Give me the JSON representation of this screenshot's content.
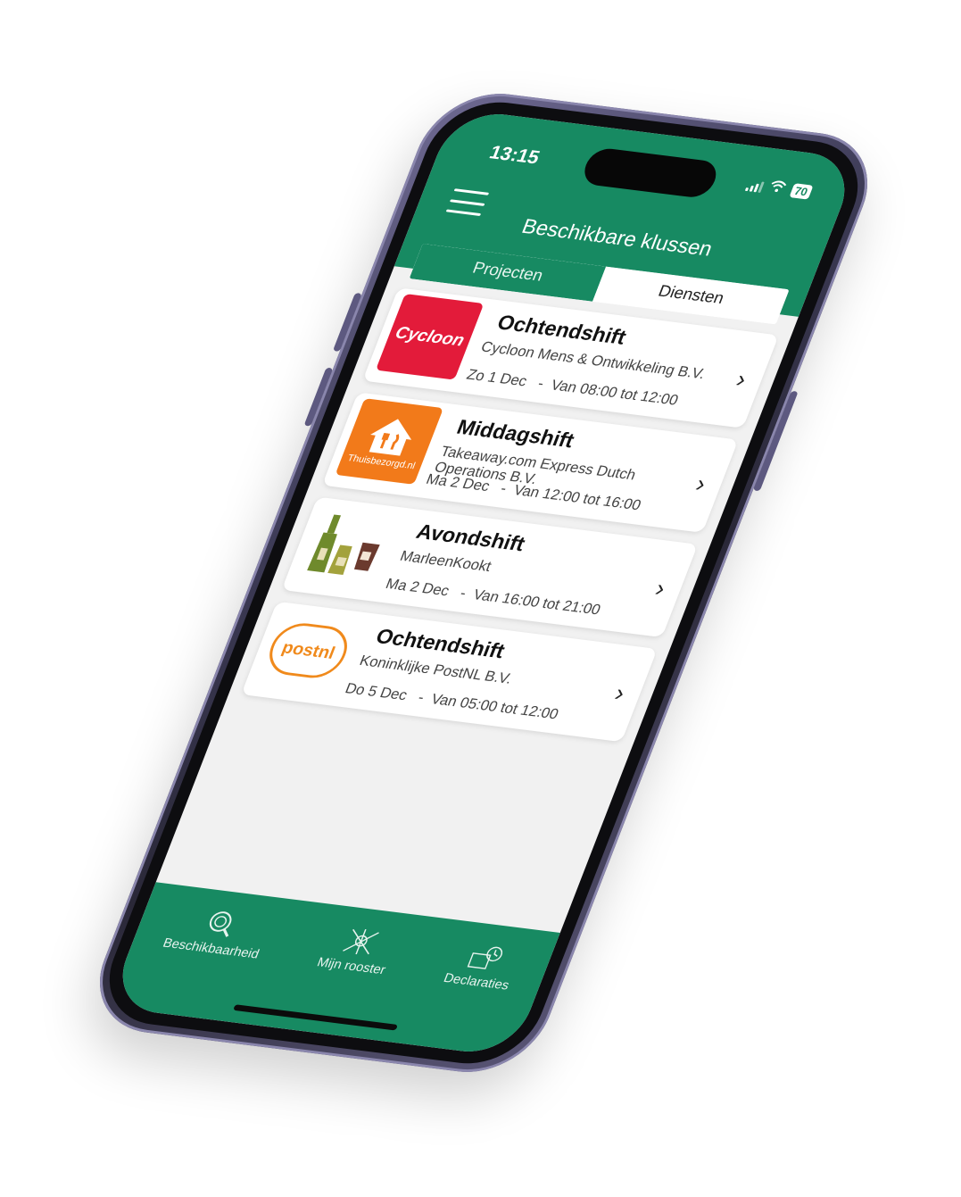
{
  "status_bar": {
    "time": "13:15",
    "battery": "70",
    "icons": [
      "signal-icon",
      "wifi-icon",
      "battery-icon"
    ]
  },
  "header": {
    "menu_icon": "hamburger-menu-icon",
    "title": "Beschikbare klussen"
  },
  "tabs": [
    {
      "label": "Projecten",
      "active": true
    },
    {
      "label": "Diensten",
      "active": false
    }
  ],
  "jobs": [
    {
      "title": "Ochtendshift",
      "company": "Cycloon Mens & Ontwikkeling B.V.",
      "when": "Zo 1 Dec   -  Van 08:00 tot 12:00",
      "logo_text": "Cycloon",
      "logo_color": "#e31b3a"
    },
    {
      "title": "Middagshift",
      "company": "Takeaway.com Express Dutch Operations B.V.",
      "when": "Ma 2 Dec   -  Van 12:00 tot 16:00",
      "logo_text": "Thuisbezorgd.nl",
      "logo_color": "#f27a1a"
    },
    {
      "title": "Avondshift",
      "company": "MarleenKookt",
      "when": "Ma 2 Dec   -  Van 16:00 tot 21:00",
      "logo_text": "",
      "logo_color": "#6f8a2c"
    },
    {
      "title": "Ochtendshift",
      "company": "Koninklijke PostNL B.V.",
      "when": "Do 5 Dec   -  Van 05:00 tot 12:00",
      "logo_text": "postnl",
      "logo_color": "#f08a1c"
    }
  ],
  "bottom_nav": [
    {
      "label": "Beschikbaarheid",
      "icon": "availability-icon"
    },
    {
      "label": "Mijn rooster",
      "icon": "schedule-icon"
    },
    {
      "label": "Declaraties",
      "icon": "declarations-icon"
    }
  ],
  "colors": {
    "primary": "#178a62",
    "background": "#f1f1f1",
    "frame": "#5d5980"
  }
}
